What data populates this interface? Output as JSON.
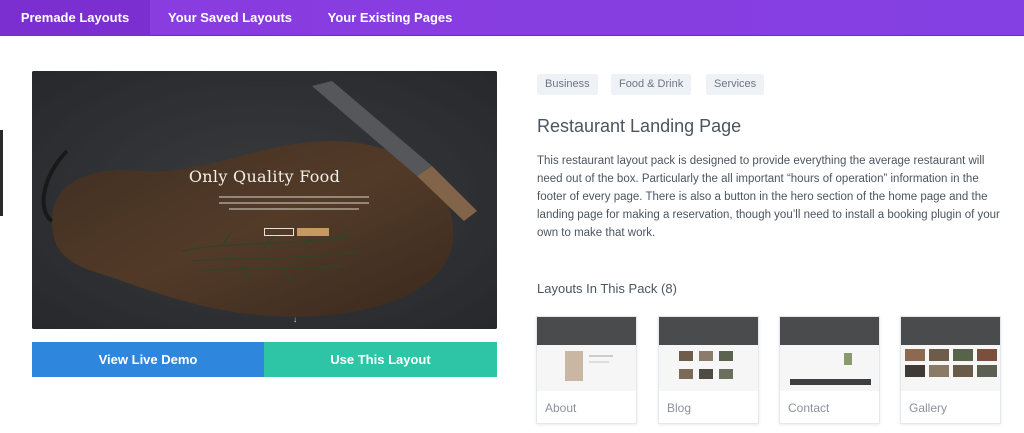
{
  "tabs": [
    {
      "label": "Premade Layouts",
      "active": true
    },
    {
      "label": "Your Saved Layouts",
      "active": false
    },
    {
      "label": "Your Existing Pages",
      "active": false
    }
  ],
  "preview": {
    "hero_title": "Only Quality Food"
  },
  "buttons": {
    "demo_label": "View Live Demo",
    "use_label": "Use This Layout"
  },
  "tags": [
    "Business",
    "Food & Drink",
    "Services"
  ],
  "layout": {
    "title": "Restaurant Landing Page",
    "description": "This restaurant layout pack is designed to provide everything the average restaurant will need out of the box. Particularly the all important “hours of operation” information in the footer of every page. There is also a button in the hero section of the home page and the landing page for making a reservation, though you’ll need to install a booking plugin of your own to make that work."
  },
  "pack": {
    "heading": "Layouts In This Pack (8)",
    "cards": [
      {
        "label": "About"
      },
      {
        "label": "Blog"
      },
      {
        "label": "Contact"
      },
      {
        "label": "Gallery"
      }
    ]
  },
  "colors": {
    "tabbar": "#8a3be0",
    "demo_button": "#2f86dd",
    "use_button": "#2ec4a6"
  }
}
